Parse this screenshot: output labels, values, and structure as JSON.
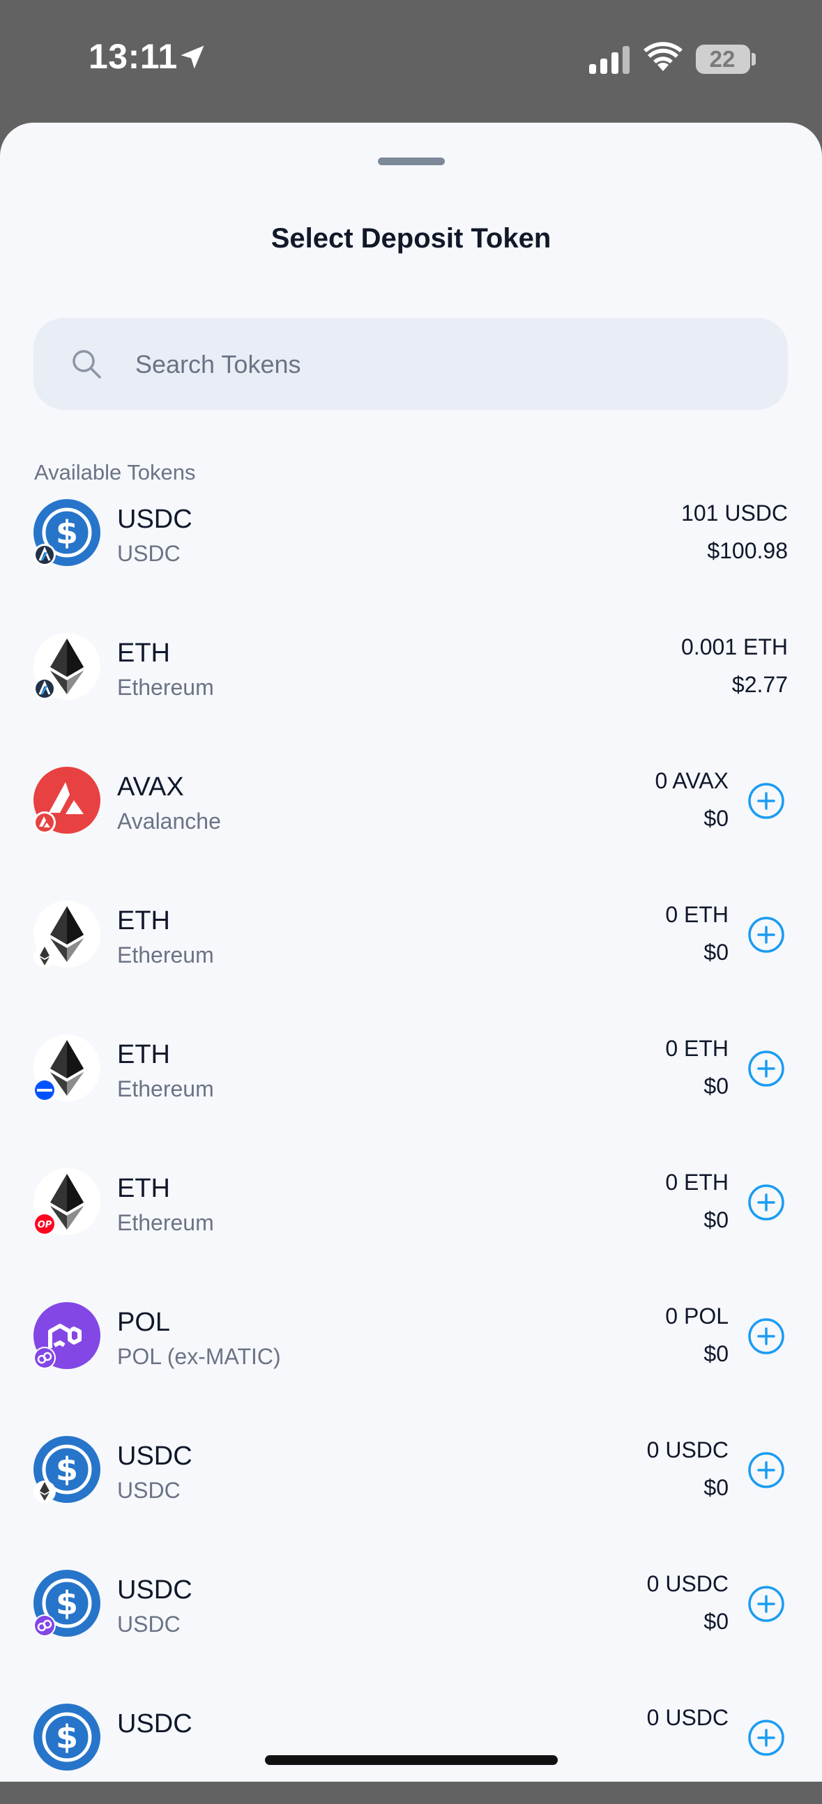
{
  "status_bar": {
    "time": "13:11",
    "battery": "22"
  },
  "sheet": {
    "title": "Select Deposit Token",
    "search": {
      "placeholder": "Search Tokens",
      "value": ""
    },
    "section_label": "Available Tokens"
  },
  "colors": {
    "accent": "#1a9cf3",
    "usdc": "#2775ca",
    "avax": "#e84142",
    "polygon": "#8247e5",
    "op": "#ff0420",
    "base": "#0052ff"
  },
  "tokens": [
    {
      "symbol": "USDC",
      "name": "USDC",
      "amount": "101 USDC",
      "value": "$100.98",
      "icon": "usdc-icon",
      "badge": "arbitrum-badge-icon",
      "add": false
    },
    {
      "symbol": "ETH",
      "name": "Ethereum",
      "amount": "0.001 ETH",
      "value": "$2.77",
      "icon": "eth-icon",
      "badge": "arbitrum-badge-icon",
      "add": false
    },
    {
      "symbol": "AVAX",
      "name": "Avalanche",
      "amount": "0 AVAX",
      "value": "$0",
      "icon": "avax-icon",
      "badge": "avalanche-badge-icon",
      "add": true
    },
    {
      "symbol": "ETH",
      "name": "Ethereum",
      "amount": "0 ETH",
      "value": "$0",
      "icon": "eth-icon",
      "badge": "ethereum-badge-icon",
      "add": true
    },
    {
      "symbol": "ETH",
      "name": "Ethereum",
      "amount": "0 ETH",
      "value": "$0",
      "icon": "eth-icon",
      "badge": "base-badge-icon",
      "add": true
    },
    {
      "symbol": "ETH",
      "name": "Ethereum",
      "amount": "0 ETH",
      "value": "$0",
      "icon": "eth-icon",
      "badge": "optimism-badge-icon",
      "add": true
    },
    {
      "symbol": "POL",
      "name": "POL (ex-MATIC)",
      "amount": "0 POL",
      "value": "$0",
      "icon": "pol-icon",
      "badge": "polygon-badge-icon",
      "add": true
    },
    {
      "symbol": "USDC",
      "name": "USDC",
      "amount": "0 USDC",
      "value": "$0",
      "icon": "usdc-icon",
      "badge": "ethereum-badge-icon",
      "add": true
    },
    {
      "symbol": "USDC",
      "name": "USDC",
      "amount": "0 USDC",
      "value": "$0",
      "icon": "usdc-icon",
      "badge": "polygon-badge-icon",
      "add": true
    },
    {
      "symbol": "USDC",
      "name": "",
      "amount": "0 USDC",
      "value": "",
      "icon": "usdc-icon",
      "badge": "",
      "add": true
    }
  ]
}
